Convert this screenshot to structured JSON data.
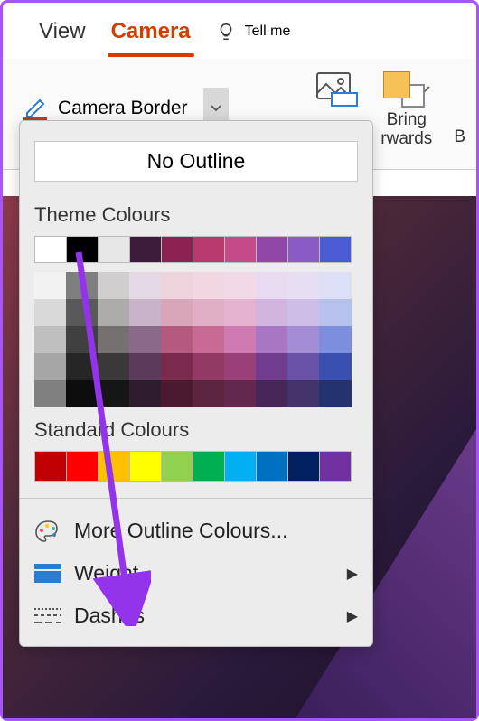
{
  "tabs": {
    "view": "View",
    "camera": "Camera",
    "tellme": "Tell me"
  },
  "ribbon": {
    "border_label": "Camera Border",
    "bring_label_l1": "Bring",
    "bring_label_l2": "rwards",
    "bring_label_l3": "B"
  },
  "dropdown": {
    "no_outline": "No Outline",
    "theme_label": "Theme Colours",
    "standard_label": "Standard Colours",
    "more": "More Outline Colours...",
    "weight": "Weight",
    "dashes": "Dashes",
    "theme_main": [
      "#ffffff",
      "#000000",
      "#e7e6e6",
      "#3a1c3a",
      "#8b2252",
      "#b83a6f",
      "#c54a8a",
      "#9048a8",
      "#8a5bc4",
      "#4a5bd4"
    ],
    "theme_shades": [
      [
        "#f2f2f2",
        "#d9d9d9",
        "#bfbfbf",
        "#a6a6a6",
        "#808080"
      ],
      [
        "#7f7f7f",
        "#595959",
        "#404040",
        "#262626",
        "#0d0d0d"
      ],
      [
        "#d0cece",
        "#aeabab",
        "#757171",
        "#3a3838",
        "#161616"
      ],
      [
        "#e4d9e4",
        "#c9b3c9",
        "#8a6a8a",
        "#5c3a5c",
        "#2e1d2e"
      ],
      [
        "#ecd3dc",
        "#d9a6b9",
        "#b35a7e",
        "#7a2a4c",
        "#4c1a30"
      ],
      [
        "#f0d7e2",
        "#e1afc5",
        "#c96a94",
        "#923a63",
        "#5c2540"
      ],
      [
        "#f2d9e7",
        "#e5b3cf",
        "#cf7ab0",
        "#9a4078",
        "#63284d"
      ],
      [
        "#e8daef",
        "#d1b5df",
        "#a877c4",
        "#6f3c8e",
        "#47265a"
      ],
      [
        "#e6def3",
        "#cdbde7",
        "#a48dd4",
        "#6a52a8",
        "#43346b"
      ],
      [
        "#dbe0f6",
        "#b7c1ed",
        "#7c8edd",
        "#3a4fb0",
        "#253270"
      ]
    ],
    "standard": [
      "#c00000",
      "#ff0000",
      "#ffc000",
      "#ffff00",
      "#92d050",
      "#00b050",
      "#00b0f0",
      "#0070c0",
      "#002060",
      "#7030a0"
    ]
  }
}
